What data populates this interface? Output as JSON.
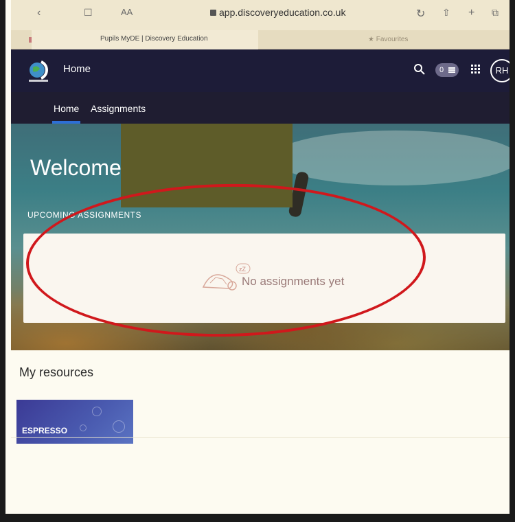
{
  "browser": {
    "url": "app.discoveryeducation.co.uk",
    "text_size_label": "AA",
    "tab_title": "Pupils MyDE | Discovery Education",
    "favourites_label": "Favourites"
  },
  "header": {
    "title": "Home",
    "notification_count": "0",
    "avatar_initials": "RH"
  },
  "nav": {
    "items": [
      {
        "label": "Home"
      },
      {
        "label": "Assignments"
      }
    ]
  },
  "hero": {
    "welcome": "Welcome,",
    "upcoming_label": "UPCOMING ASSIGNMENTS",
    "empty_message": "No assignments yet",
    "empty_icon": "sleeping-turtle-icon",
    "sleep_glyph": "zZ"
  },
  "resources": {
    "title": "My resources",
    "items": [
      {
        "label": "ESPRESSO"
      }
    ]
  },
  "colors": {
    "header_bg": "#1d1c38",
    "nav_active": "#2d6fd6",
    "highlight_circle": "#d0181c",
    "espresso_tile": "#3b3a95"
  }
}
